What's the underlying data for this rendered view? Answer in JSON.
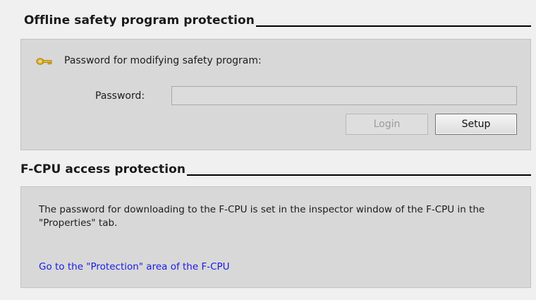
{
  "offline_section": {
    "title": "Offline safety program protection",
    "password_heading": "Password for modifying safety program:",
    "password_label": "Password:",
    "password_value": "",
    "password_placeholder": "",
    "login_label": "Login",
    "setup_label": "Setup",
    "icon": "key-icon"
  },
  "fcpu_section": {
    "title": "F-CPU access protection",
    "description": "The password for downloading to the F-CPU is set in the inspector window of the F-CPU in the \"Properties\" tab.",
    "link_text": "Go to the \"Protection\" area of the F-CPU"
  },
  "colors": {
    "panel_bg": "#d8d8d8",
    "page_bg": "#f0f0f0",
    "link": "#1a1ae6",
    "key_icon": "#e8b820"
  }
}
